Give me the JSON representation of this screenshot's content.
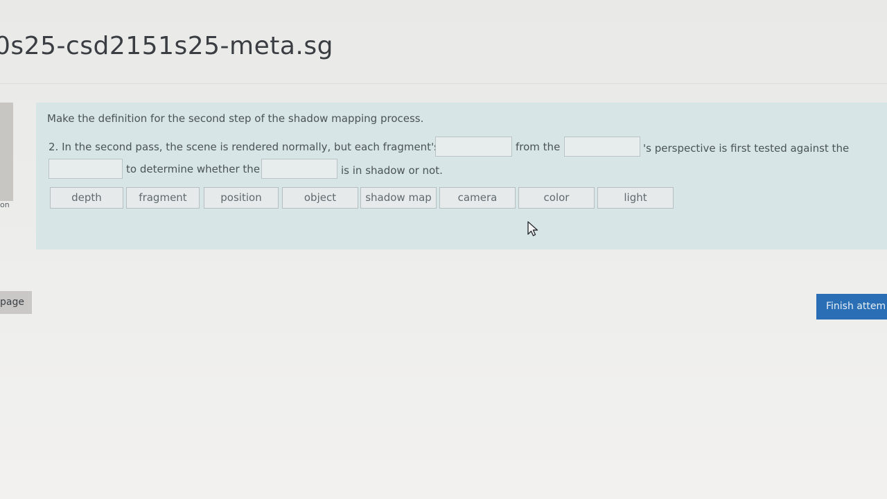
{
  "page_title": "0s25-csd2151s25-meta.sg",
  "left_nav": {
    "label": "on"
  },
  "question": {
    "prompt": "Make the definition for the second step of the shadow mapping process.",
    "line1_part1": "2. In the second pass, the scene is rendered normally, but each fragment's",
    "line1_part2": "from the",
    "line1_part3": "'s perspective is first tested against the",
    "line2_part1": "to determine whether the",
    "line2_part2": "is in shadow or not.",
    "choices": [
      "depth",
      "fragment",
      "position",
      "object",
      "shadow map",
      "camera",
      "color",
      "light"
    ]
  },
  "nav": {
    "prev_label": "page",
    "finish_label": "Finish attem"
  },
  "colors": {
    "question_background": "#d7e5e6",
    "finish_button": "#2a6eb5"
  }
}
